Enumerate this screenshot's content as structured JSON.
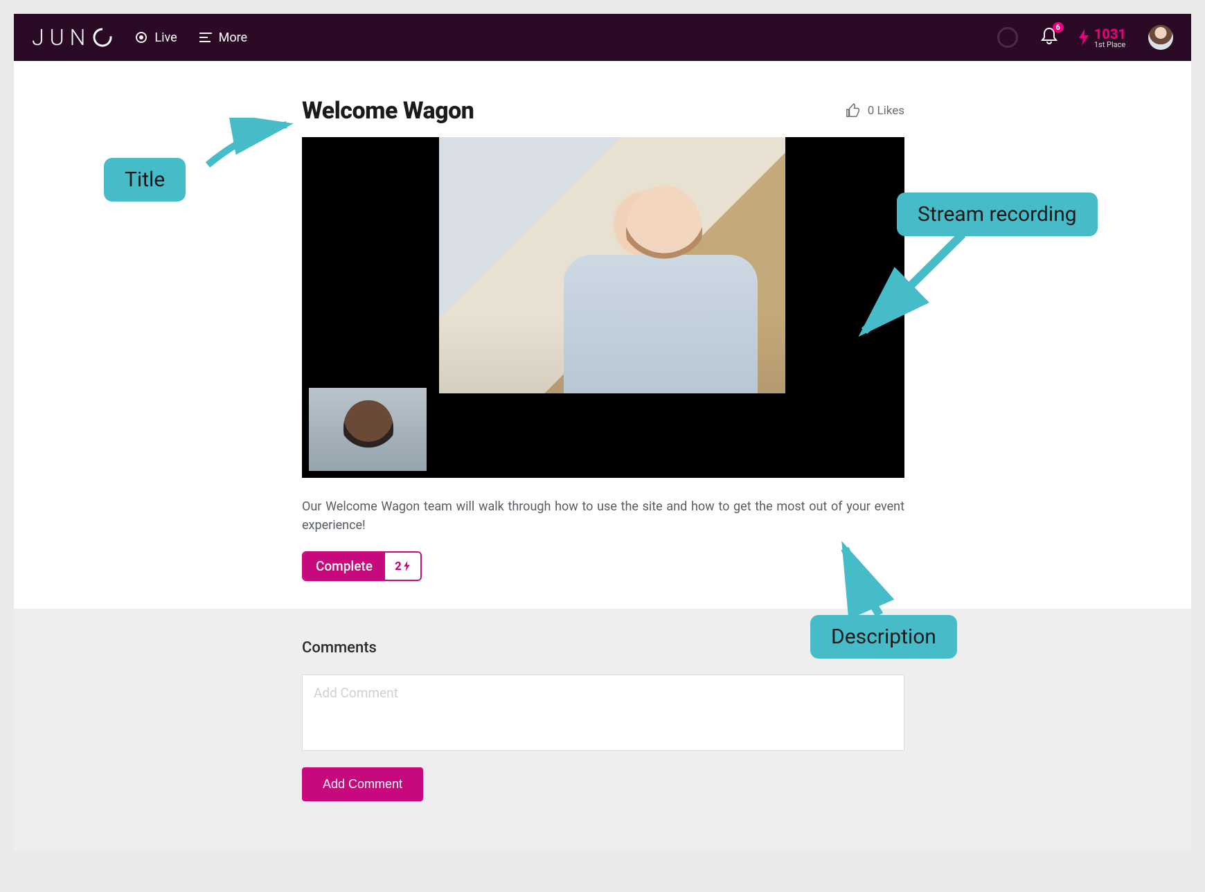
{
  "header": {
    "logo_text": "JUN",
    "nav": {
      "live": "Live",
      "more": "More"
    },
    "notification_count": "6",
    "score": "1031",
    "score_sub": "1st Place"
  },
  "page": {
    "title": "Welcome Wagon",
    "likes_text": "0 Likes",
    "description": "Our Welcome Wagon team will walk through how to use the site and how to get the most out of your event experience!",
    "complete_label": "Complete",
    "complete_points": "2"
  },
  "comments": {
    "heading": "Comments",
    "placeholder": "Add Comment",
    "button": "Add Comment"
  },
  "callouts": {
    "title": "Title",
    "stream": "Stream recording",
    "description": "Description"
  }
}
